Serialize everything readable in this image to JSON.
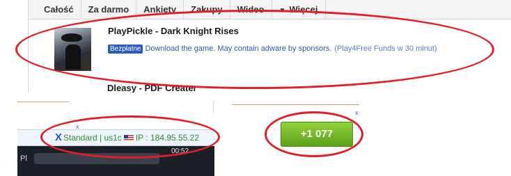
{
  "tabs": [
    {
      "label": "Całość"
    },
    {
      "label": "Za darmo"
    },
    {
      "label": "Ankiety"
    },
    {
      "label": "Zakupy"
    },
    {
      "label": "Wideo"
    },
    {
      "label": "Więcej",
      "icon": "caret-down-icon"
    }
  ],
  "offer": {
    "title": "PlayPickle - Dark Knight Rises",
    "badge": "Bezpłatne",
    "description": "Download the game. May contain adware by sponsors.",
    "funds": "(Play4Free Funds w 30 minut)"
  },
  "next_offer": {
    "title": "Dleasy - PDF Creater"
  },
  "close_marks": {
    "left": "x",
    "right": "x"
  },
  "infobar": {
    "text_before_flag": "Standard | us1c",
    "flag_icon": "us-flag-icon",
    "ip_text": "IP : 184.95.55.22"
  },
  "taskbar": {
    "time": "00:52",
    "label": "Pl"
  },
  "counter_button": {
    "label": "+1 077"
  },
  "colors": {
    "highlight": "#e21e26",
    "button_green": "#6fb626",
    "link_blue": "#2e57a8",
    "infobar_green": "#2f8a2f"
  }
}
